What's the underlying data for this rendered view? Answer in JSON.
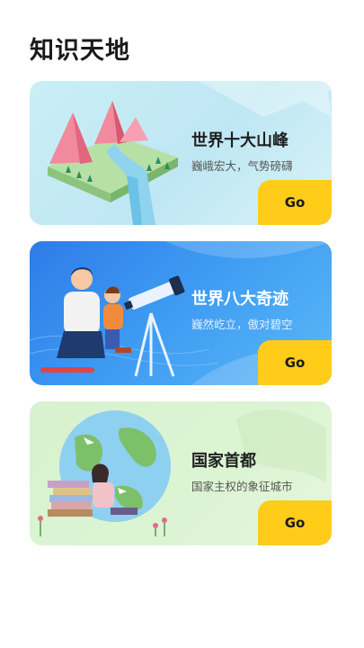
{
  "header": {
    "title": "知识天地"
  },
  "cards": [
    {
      "title": "世界十大山峰",
      "subtitle": "巍峨宏大，气势磅礴",
      "button": "Go"
    },
    {
      "title": "世界八大奇迹",
      "subtitle": "巍然屹立，傲对碧空",
      "button": "Go"
    },
    {
      "title": "国家首都",
      "subtitle": "国家主权的象征城市",
      "button": "Go"
    }
  ],
  "colors": {
    "accent": "#ffcc1a",
    "card1_bg": "#c9eef6",
    "card2_bg": "#3d8ff0",
    "card3_bg": "#d9f3d0"
  }
}
